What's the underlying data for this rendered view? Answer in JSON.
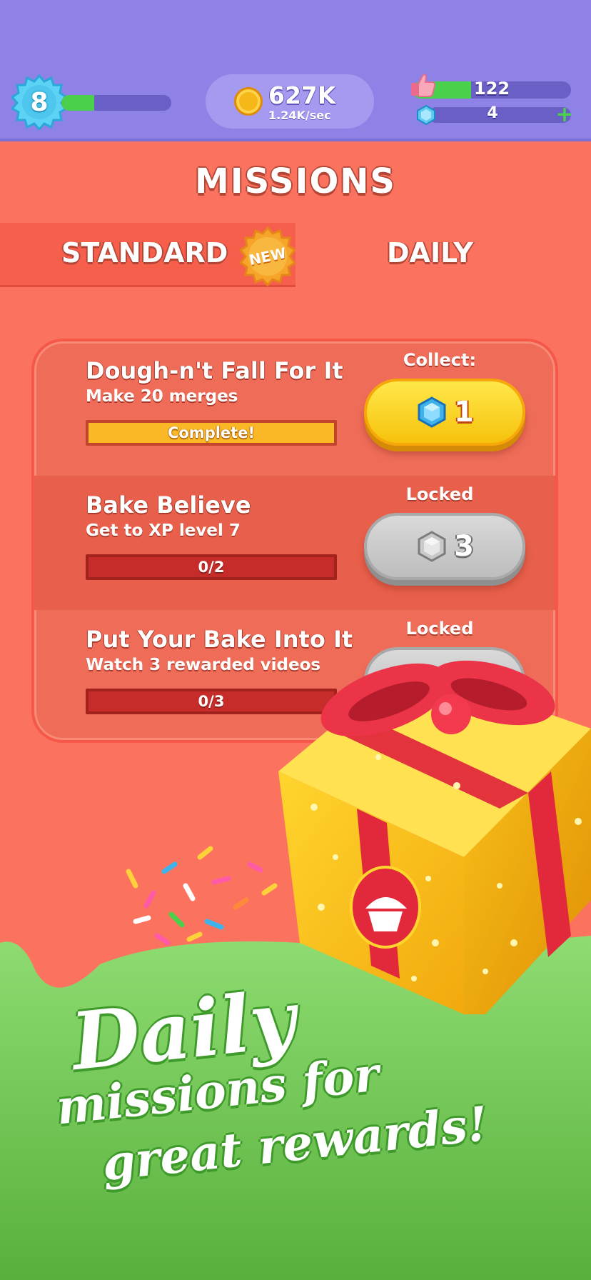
{
  "header": {
    "level": "8",
    "xp_progress": 0.3,
    "coins": "627K",
    "coin_rate": "1.24K/sec",
    "likes": "122",
    "likes_progress": 0.37,
    "gems": "4"
  },
  "missions_title": "MISSIONS",
  "tabs": {
    "standard": "STANDARD",
    "new_badge": "NEW",
    "daily": "DAILY"
  },
  "missions": [
    {
      "title": "Dough-n't Fall For It",
      "description": "Make 20 merges",
      "progress_text": "Complete!",
      "status_label": "Collect:",
      "reward": "1",
      "state": "complete"
    },
    {
      "title": "Bake Believe",
      "description": "Get to XP level 7",
      "progress_text": "0/2",
      "status_label": "Locked",
      "reward": "3",
      "state": "locked"
    },
    {
      "title": "Put Your Bake Into It",
      "description": "Watch 3 rewarded videos",
      "progress_text": "0/3",
      "status_label": "Locked",
      "reward": "",
      "state": "locked"
    }
  ],
  "promo": {
    "line1": "Daily",
    "line2": "missions for",
    "line3": "great rewards!"
  },
  "icons": [
    "level-star-icon",
    "coin-icon",
    "thumbs-up-icon",
    "gem-icon",
    "plus-icon",
    "gift-box-icon",
    "cupcake-icon"
  ],
  "colors": {
    "top_bar": "#8e82e6",
    "background": "#fb735f",
    "gold_button": "#f6c20c",
    "locked_button": "#bdbdbd",
    "promo_green": "#6cc04a"
  }
}
